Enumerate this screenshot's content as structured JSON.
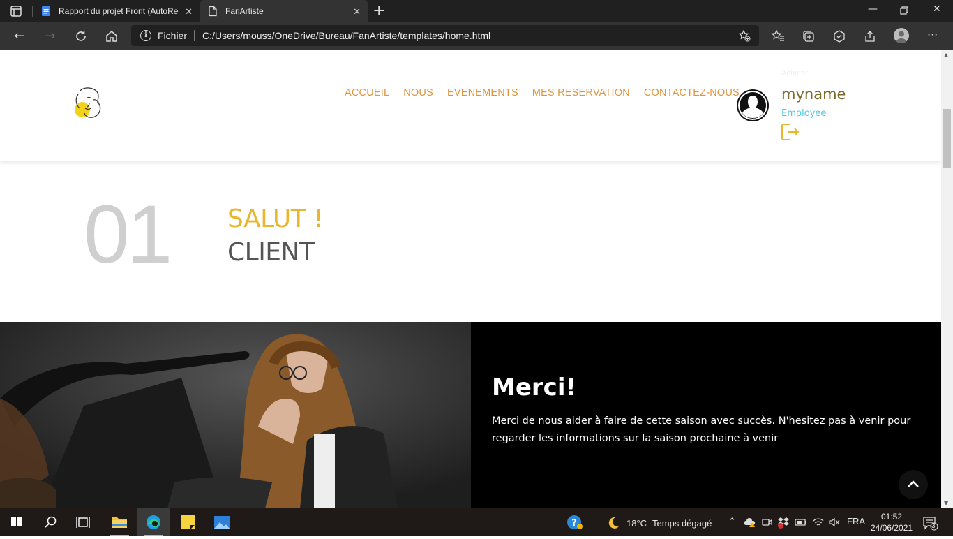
{
  "browser": {
    "tabs": [
      {
        "title": "Rapport du projet Front (AutoRe",
        "icon": "docs-icon",
        "active": false
      },
      {
        "title": "FanArtiste",
        "icon": "page-icon",
        "active": true
      }
    ],
    "address": {
      "scheme_label": "Fichier",
      "url": "C:/Users/mouss/OneDrive/Bureau/FanArtiste/templates/home.html"
    }
  },
  "header": {
    "menu": [
      {
        "label": "ACCUEIL"
      },
      {
        "label": "NOUS"
      },
      {
        "label": "EVENEMENTS"
      },
      {
        "label": "MES RESERVATION"
      },
      {
        "label": "CONTACTEZ-NOUS"
      }
    ],
    "user": {
      "faint_label": "Acheter",
      "name": "myname",
      "role": "Employee"
    }
  },
  "intro": {
    "number": "01",
    "greeting": "SALUT !",
    "audience": "CLIENT"
  },
  "thanks": {
    "title": "Merci!",
    "text": "Merci de nous aider à faire de cette saison avec succès. N'hesitez pas à venir pour regarder les informations sur la saison prochaine à venir"
  },
  "taskbar": {
    "weather": {
      "temperature": "18°C",
      "condition": "Temps dégagé"
    },
    "language": "FRA",
    "time": "01:52",
    "date": "24/06/2021",
    "notifications": "3"
  },
  "colors": {
    "menu": "#e0953a",
    "greeting": "#e8b730",
    "role": "#4dc8dc",
    "dark_panel": "#000000"
  }
}
